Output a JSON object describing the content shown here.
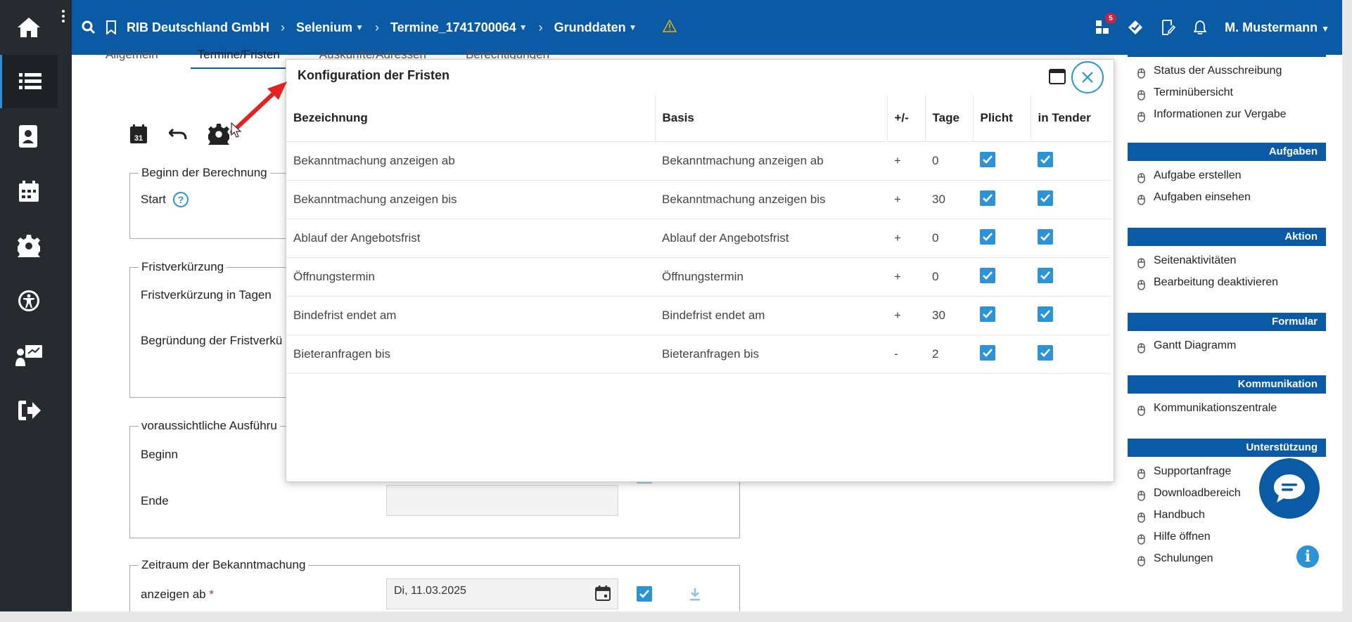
{
  "topbar": {
    "company": "RIB Deutschland GmbH",
    "crumb1": "Selenium",
    "crumb2": "Termine_1741700064",
    "crumb3": "Grunddaten",
    "notif_count": "5",
    "user": "M. Mustermann"
  },
  "tabs": [
    "Allgemein",
    "Termine/Fristen",
    "Auskünfte/Adressen",
    "Berechtigungen"
  ],
  "form": {
    "beginn_legend": "Beginn der Berechnung",
    "start_label": "Start",
    "fristverk_legend": "Fristverkürzung",
    "fristverk_tage": "Fristverkürzung in Tagen",
    "begruendung": "Begründung der Fristverkü",
    "ausfuehrung_legend": "voraussichtliche Ausführu",
    "beginn": "Beginn",
    "ende": "Ende",
    "zeitraum_legend": "Zeitraum der Bekanntmachung",
    "anzeigen_ab": "anzeigen ab",
    "required_mark": "*",
    "anzeigen_ab_value": "Di, 11.03.2025"
  },
  "modal": {
    "title": "Konfiguration der Fristen",
    "columns": [
      "Bezeichnung",
      "Basis",
      "+/-",
      "Tage",
      "Plicht",
      "in Tender"
    ],
    "rows": [
      {
        "bez": "Bekanntmachung anzeigen ab",
        "basis": "Bekanntmachung anzeigen ab",
        "sign": "+",
        "tage": "0"
      },
      {
        "bez": "Bekanntmachung anzeigen bis",
        "basis": "Bekanntmachung anzeigen bis",
        "sign": "+",
        "tage": "30"
      },
      {
        "bez": "Ablauf der Angebotsfrist",
        "basis": "Ablauf der Angebotsfrist",
        "sign": "+",
        "tage": "0"
      },
      {
        "bez": "Öffnungstermin",
        "basis": "Öffnungstermin",
        "sign": "+",
        "tage": "0"
      },
      {
        "bez": "Bindefrist endet am",
        "basis": "Bindefrist endet am",
        "sign": "+",
        "tage": "30"
      },
      {
        "bez": "Bieteranfragen bis",
        "basis": "Bieteranfragen bis",
        "sign": "-",
        "tage": "2"
      }
    ]
  },
  "sidebar": {
    "top_links": [
      "Status der Ausschreibung",
      "Terminübersicht",
      "Informationen zur Vergabe"
    ],
    "sections": [
      {
        "title": "Aufgaben",
        "links": [
          "Aufgabe erstellen",
          "Aufgaben einsehen"
        ]
      },
      {
        "title": "Aktion",
        "links": [
          "Seitenaktivitäten",
          "Bearbeitung deaktivieren"
        ]
      },
      {
        "title": "Formular",
        "links": [
          "Gantt Diagramm"
        ]
      },
      {
        "title": "Kommunikation",
        "links": [
          "Kommunikationszentrale"
        ]
      },
      {
        "title": "Unterstützung",
        "links": [
          "Supportanfrage",
          "Downloadbereich",
          "Handbuch",
          "Hilfe öffnen",
          "Schulungen"
        ]
      }
    ]
  },
  "colors": {
    "brand": "#0b5aa5",
    "accent": "#2b93d6",
    "rail": "#272b2f"
  }
}
